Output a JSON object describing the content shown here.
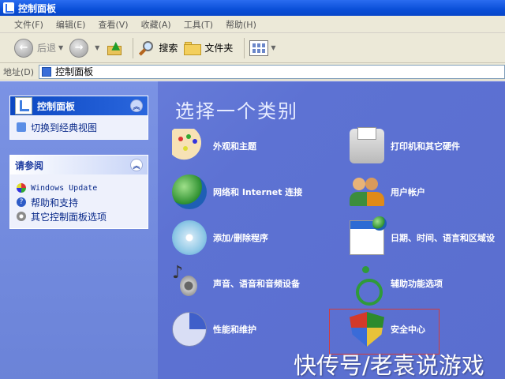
{
  "window": {
    "title": "控制面板"
  },
  "menu": [
    "文件(F)",
    "编辑(E)",
    "查看(V)",
    "收藏(A)",
    "工具(T)",
    "帮助(H)"
  ],
  "toolbar": {
    "back_label": "后退",
    "search_label": "搜索",
    "folders_label": "文件夹"
  },
  "address": {
    "label": "地址(D)",
    "value": "控制面板"
  },
  "left_pane": {
    "control_panel": {
      "title": "控制面板",
      "items": [
        "切换到经典视图"
      ]
    },
    "see_also": {
      "title": "请参阅",
      "items": [
        "Windows Update",
        "帮助和支持",
        "其它控制面板选项"
      ]
    }
  },
  "main": {
    "heading": "选择一个类别",
    "categories": [
      {
        "label": "外观和主题",
        "icon": "appearance-icon"
      },
      {
        "label": "打印机和其它硬件",
        "icon": "printer-icon"
      },
      {
        "label": "网络和 Internet 连接",
        "icon": "network-icon"
      },
      {
        "label": "用户帐户",
        "icon": "users-icon"
      },
      {
        "label": "添加/删除程序",
        "icon": "add-remove-icon"
      },
      {
        "label": "日期、时间、语言和区域设",
        "icon": "date-time-icon"
      },
      {
        "label": "声音、语音和音频设备",
        "icon": "sound-icon"
      },
      {
        "label": "辅助功能选项",
        "icon": "accessibility-icon"
      },
      {
        "label": "性能和维护",
        "icon": "performance-icon"
      },
      {
        "label": "安全中心",
        "icon": "security-shield-icon"
      }
    ]
  },
  "watermark": "快传号/老袁说游戏",
  "colors": {
    "titlebar": "#0a4fd8",
    "main_bg": "#5d72d3",
    "highlight_border": "#d23c3c"
  }
}
